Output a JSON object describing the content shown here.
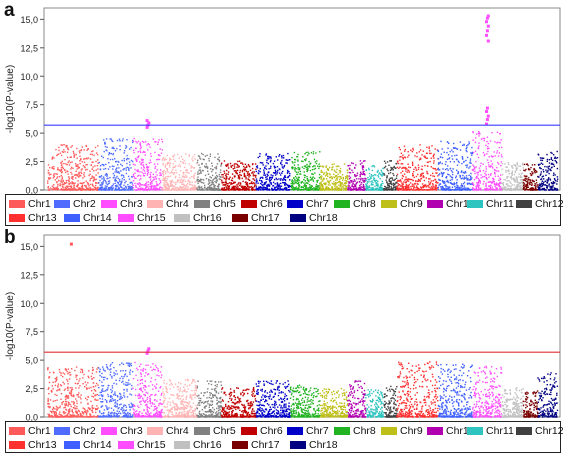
{
  "chart_data": [
    {
      "panel_label": "a",
      "type": "scatter",
      "subtype": "manhattan",
      "ylabel": "-log10(P-value)",
      "xlabel": "",
      "ylim": [
        0,
        16
      ],
      "yticks": [
        "0,0",
        "2,5",
        "5,0",
        "7,5",
        "10,0",
        "12,5",
        "15,0"
      ],
      "ytick_values": [
        0,
        2.5,
        5,
        7.5,
        10,
        12.5,
        15
      ],
      "threshold": {
        "value": 5.7,
        "color": "#3b3bff"
      },
      "grid": false,
      "legend_position": "bottom",
      "series": [
        {
          "name": "Chr1",
          "color": "#ff5a5a",
          "peak": 4.0,
          "top_points": []
        },
        {
          "name": "Chr2",
          "color": "#4f6cff",
          "peak": 4.5,
          "top_points": []
        },
        {
          "name": "Chr3",
          "color": "#ff4dff",
          "peak": 4.6,
          "top_points": [
            5.5,
            5.7,
            5.9,
            6.1
          ]
        },
        {
          "name": "Chr4",
          "color": "#ffb3b3",
          "peak": 3.2,
          "top_points": []
        },
        {
          "name": "Chr5",
          "color": "#808080",
          "peak": 3.3,
          "top_points": []
        },
        {
          "name": "Chr6",
          "color": "#c00000",
          "peak": 2.6,
          "top_points": []
        },
        {
          "name": "Chr7",
          "color": "#0000c8",
          "peak": 3.2,
          "top_points": []
        },
        {
          "name": "Chr8",
          "color": "#22b322",
          "peak": 3.4,
          "top_points": []
        },
        {
          "name": "Chr9",
          "color": "#bfbf1a",
          "peak": 2.3,
          "top_points": []
        },
        {
          "name": "Chr10",
          "color": "#b000b0",
          "peak": 2.6,
          "top_points": []
        },
        {
          "name": "Chr11",
          "color": "#2ec4bf",
          "peak": 2.2,
          "top_points": []
        },
        {
          "name": "Chr12",
          "color": "#404040",
          "peak": 2.6,
          "top_points": []
        },
        {
          "name": "Chr13",
          "color": "#ff3030",
          "peak": 4.0,
          "top_points": []
        },
        {
          "name": "Chr14",
          "color": "#3f60ff",
          "peak": 4.3,
          "top_points": []
        },
        {
          "name": "Chr15",
          "color": "#ff4dff",
          "peak": 5.2,
          "top_points": [
            5.8,
            6.2,
            6.5,
            6.9,
            7.2,
            13.1,
            13.6,
            14.0,
            14.4,
            14.8,
            15.1,
            15.3
          ]
        },
        {
          "name": "Chr16",
          "color": "#c0c0c0",
          "peak": 2.4,
          "top_points": []
        },
        {
          "name": "Chr17",
          "color": "#7a0000",
          "peak": 2.3,
          "top_points": []
        },
        {
          "name": "Chr18",
          "color": "#000080",
          "peak": 3.4,
          "top_points": []
        }
      ]
    },
    {
      "panel_label": "b",
      "type": "scatter",
      "subtype": "manhattan",
      "ylabel": "-log10(P-value)",
      "xlabel": "",
      "ylim": [
        0,
        16
      ],
      "yticks": [
        "0,0",
        "2,5",
        "5,0",
        "7,5",
        "10,0",
        "12,5",
        "15,0"
      ],
      "ytick_values": [
        0,
        2.5,
        5,
        7.5,
        10,
        12.5,
        15
      ],
      "threshold": {
        "value": 5.7,
        "color": "#e03030"
      },
      "grid": false,
      "legend_position": "bottom",
      "series": [
        {
          "name": "Chr1",
          "color": "#ff5a5a",
          "peak": 4.4,
          "top_points": [
            15.2
          ]
        },
        {
          "name": "Chr2",
          "color": "#4f6cff",
          "peak": 4.8,
          "top_points": []
        },
        {
          "name": "Chr3",
          "color": "#ff4dff",
          "peak": 4.8,
          "top_points": [
            5.6,
            5.8,
            6.0
          ]
        },
        {
          "name": "Chr4",
          "color": "#ffb3b3",
          "peak": 3.3,
          "top_points": []
        },
        {
          "name": "Chr5",
          "color": "#808080",
          "peak": 3.2,
          "top_points": []
        },
        {
          "name": "Chr6",
          "color": "#c00000",
          "peak": 2.6,
          "top_points": []
        },
        {
          "name": "Chr7",
          "color": "#0000c8",
          "peak": 3.2,
          "top_points": []
        },
        {
          "name": "Chr8",
          "color": "#22b322",
          "peak": 2.8,
          "top_points": []
        },
        {
          "name": "Chr9",
          "color": "#bfbf1a",
          "peak": 2.5,
          "top_points": []
        },
        {
          "name": "Chr10",
          "color": "#b000b0",
          "peak": 3.3,
          "top_points": []
        },
        {
          "name": "Chr11",
          "color": "#2ec4bf",
          "peak": 2.4,
          "top_points": []
        },
        {
          "name": "Chr12",
          "color": "#404040",
          "peak": 2.7,
          "top_points": []
        },
        {
          "name": "Chr13",
          "color": "#ff3030",
          "peak": 4.9,
          "top_points": []
        },
        {
          "name": "Chr14",
          "color": "#3f60ff",
          "peak": 4.7,
          "top_points": []
        },
        {
          "name": "Chr15",
          "color": "#ff4dff",
          "peak": 4.5,
          "top_points": []
        },
        {
          "name": "Chr16",
          "color": "#c0c0c0",
          "peak": 2.6,
          "top_points": []
        },
        {
          "name": "Chr17",
          "color": "#7a0000",
          "peak": 2.3,
          "top_points": []
        },
        {
          "name": "Chr18",
          "color": "#000080",
          "peak": 3.9,
          "top_points": []
        }
      ]
    }
  ]
}
